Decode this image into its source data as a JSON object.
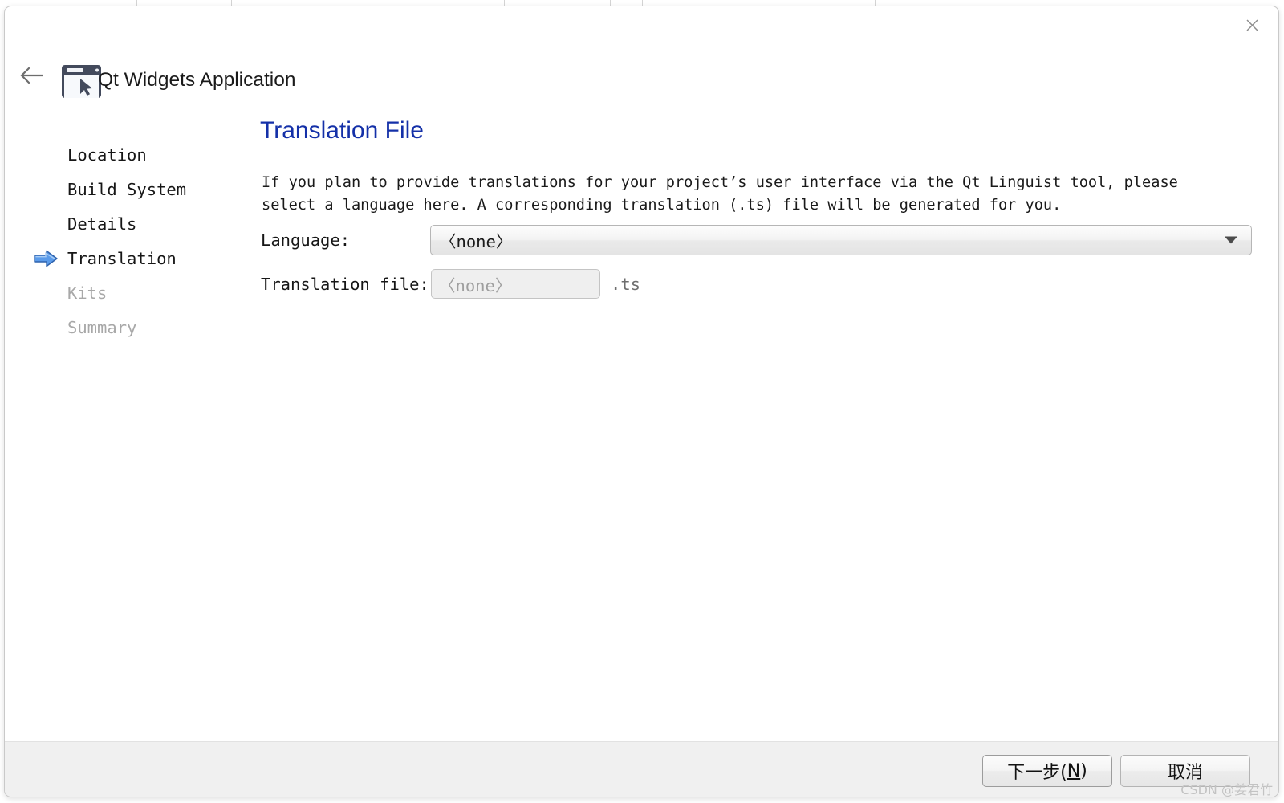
{
  "window": {
    "close_label": "✕",
    "back_label": "←",
    "app_title": "Qt Widgets Application",
    "app_icon": "qt-widgets-app-icon"
  },
  "nav": {
    "items": [
      {
        "label": "Location",
        "state": "done",
        "current": false
      },
      {
        "label": "Build System",
        "state": "done",
        "current": false
      },
      {
        "label": "Details",
        "state": "done",
        "current": false
      },
      {
        "label": "Translation",
        "state": "current",
        "current": true
      },
      {
        "label": "Kits",
        "state": "pending",
        "current": false
      },
      {
        "label": "Summary",
        "state": "pending",
        "current": false
      }
    ]
  },
  "main": {
    "page_title": "Translation File",
    "description": "If you plan to provide translations for your project’s user interface via the Qt Linguist tool, please select a language here. A corresponding translation (.ts) file will be generated for you.",
    "language": {
      "label": "Language:",
      "value": "〈none〉",
      "options": [
        "〈none〉"
      ]
    },
    "translation_file": {
      "label": "Translation file:",
      "value": "",
      "placeholder": "〈none〉",
      "suffix": ".ts"
    }
  },
  "footer": {
    "next_label_main": "下一步(",
    "next_accel": "N",
    "next_label_tail": ")",
    "cancel_label": "取消"
  },
  "watermark": {
    "text": "CSDN @姜君竹"
  },
  "colors": {
    "accent_title": "#1430a8",
    "nav_arrow": "#3a7fd5",
    "footer_bg": "#f0f0f0",
    "icon_dark": "#434a5c"
  }
}
